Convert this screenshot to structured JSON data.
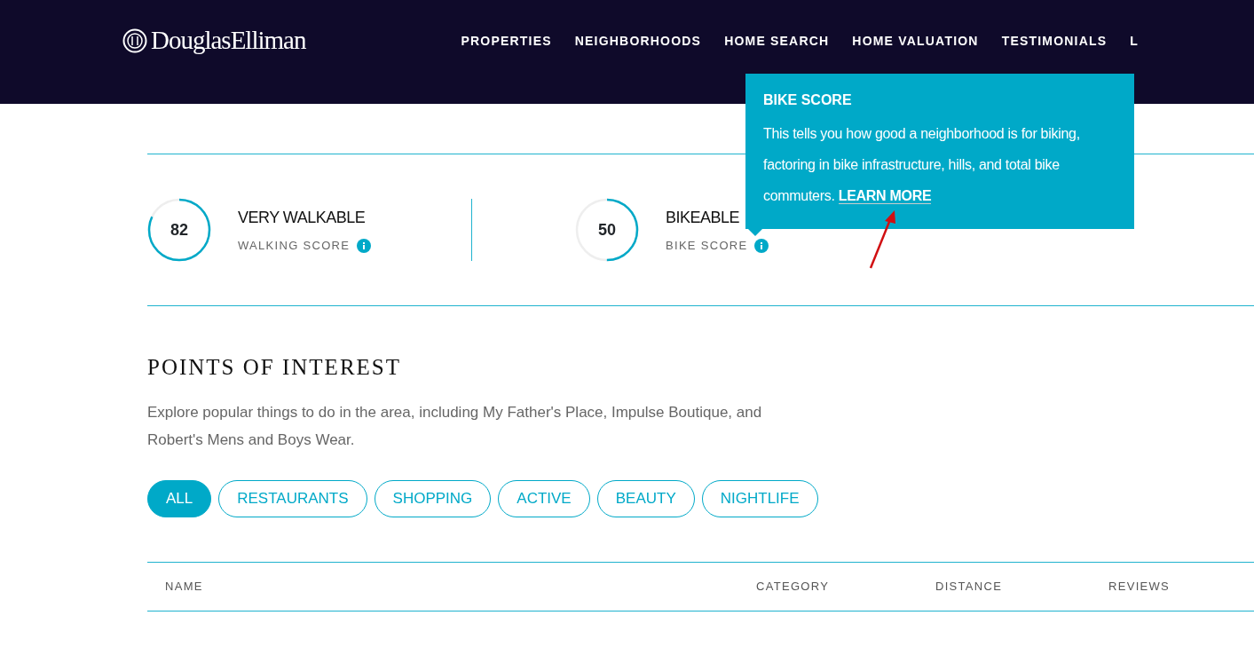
{
  "header": {
    "logo": "DouglasElliman",
    "nav": [
      "PROPERTIES",
      "NEIGHBORHOODS",
      "HOME SEARCH",
      "HOME VALUATION",
      "TESTIMONIALS",
      "L"
    ]
  },
  "scores": [
    {
      "value": "82",
      "title": "VERY WALKABLE",
      "label": "WALKING SCORE"
    },
    {
      "value": "50",
      "title": "BIKEABLE",
      "label": "BIKE SCORE"
    }
  ],
  "tooltip": {
    "title": "BIKE SCORE",
    "text": "This tells you how good a neighborhood is for biking, factoring in bike infrastructure, hills, and total bike commuters.",
    "link": "LEARN MORE"
  },
  "points_of_interest": {
    "heading": "POINTS OF INTEREST",
    "description": "Explore popular things to do in the area, including My Father's Place, Impulse Boutique, and Robert's Mens and Boys Wear.",
    "filters": [
      {
        "label": "ALL",
        "selected": true
      },
      {
        "label": "RESTAURANTS",
        "selected": false
      },
      {
        "label": "SHOPPING",
        "selected": false
      },
      {
        "label": "ACTIVE",
        "selected": false
      },
      {
        "label": "BEAUTY",
        "selected": false
      },
      {
        "label": "NIGHTLIFE",
        "selected": false
      }
    ],
    "table": {
      "columns": [
        "NAME",
        "CATEGORY",
        "DISTANCE",
        "REVIEWS"
      ]
    }
  }
}
